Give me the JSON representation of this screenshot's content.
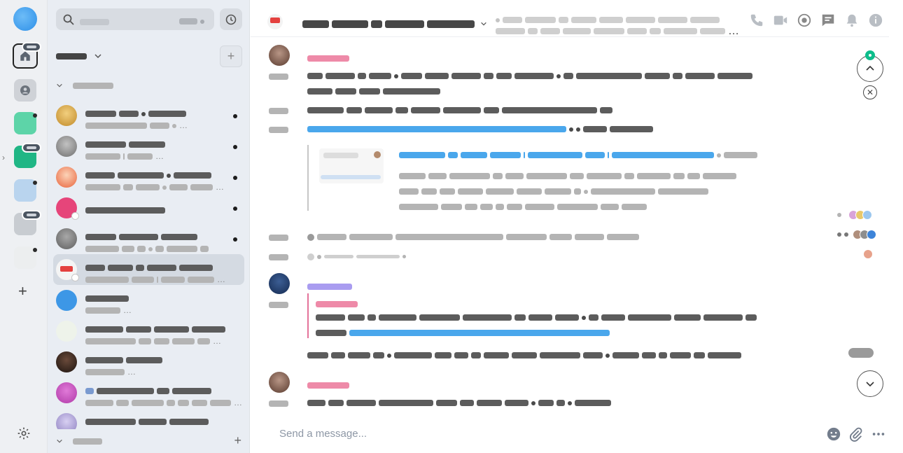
{
  "composer": {
    "placeholder": "Send a message..."
  },
  "colors": {
    "accent": "#0dbd8b",
    "link": "#4aa7ec",
    "sender_pink": "#ee8aa8",
    "sender_violet": "#a99cf0",
    "sidebar_bg": "#e9edf3",
    "rail_bg": "#eef0f3",
    "header_room_avatar": "#e4413f"
  },
  "icons": {
    "rail": [
      "app-logo-icon",
      "home-icon",
      "people-icon",
      "plus-icon",
      "chevron-right-icon",
      "settings-icon"
    ],
    "sidebar": [
      "search-icon",
      "history-icon",
      "plus-icon",
      "chevron-down-icon"
    ],
    "header": [
      "voice-call-icon",
      "video-call-icon",
      "threads-icon",
      "chat-icon",
      "bell-icon",
      "info-icon"
    ],
    "composer": [
      "emoji-icon",
      "attachment-icon",
      "more-icon"
    ],
    "timeline": [
      "chevron-up-icon",
      "close-icon",
      "chevron-down-icon"
    ]
  },
  "sidebar": {
    "rooms": [
      {
        "av": "#d9a441",
        "unread": true,
        "active": false
      },
      {
        "av": "#9b9b9b",
        "unread": true,
        "active": false
      },
      {
        "av": "#e9643c",
        "unread": true,
        "active": false
      },
      {
        "av": "#e6457a",
        "unread": true,
        "active": false
      },
      {
        "av": "#8a8a8a",
        "unread": true,
        "active": false
      },
      {
        "av": "#e4413f",
        "unread": false,
        "active": true
      },
      {
        "av": "#3d97e6",
        "unread": false,
        "active": false
      },
      {
        "av": "#dfe9d9",
        "unread": false,
        "active": false
      },
      {
        "av": "#3b2a22",
        "unread": false,
        "active": false
      },
      {
        "av": "#c040b0",
        "unread": false,
        "active": false
      },
      {
        "av": "#9a8ec2",
        "unread": false,
        "active": false
      }
    ]
  }
}
